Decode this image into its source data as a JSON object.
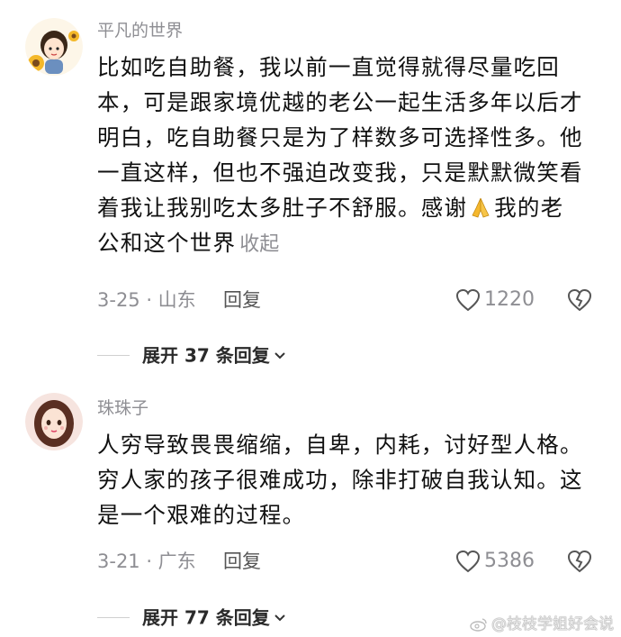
{
  "comments": [
    {
      "username": "平凡的世界",
      "avatar_icon": "girl-with-sunflower-avatar",
      "text_lines": [
        "比如吃自助餐，我以前一直觉得就得尽量吃回",
        "本，可是跟家境优越的老公一起生活多年以后才",
        "明白，吃自助餐只是为了样数多可选择性多。他",
        "一直这样，但也不强迫改变我，只是默默微笑看",
        "着我让我别吃太多肚子不舒服。感谢",
        "我的老"
      ],
      "text_line_6_pre": "公和这个世界",
      "collapse_label": "收起",
      "emoji": "folded-hands-emoji",
      "date_location": "3-25 · 山东",
      "reply_label": "回复",
      "like_count": "1220",
      "expand_label": "展开 37 条回复"
    },
    {
      "username": "珠珠子",
      "avatar_icon": "cartoon-girl-avatar",
      "text_lines": [
        "人穷导致畏畏缩缩，自卑，内耗，讨好型人格。",
        "穷人家的孩子很难成功，除非打破自我认知。这",
        "是一个艰难的过程。"
      ],
      "date_location": "3-21 · 广东",
      "reply_label": "回复",
      "like_count": "5386",
      "expand_label": "展开 77 条回复"
    }
  ],
  "watermark": "@枝枝学姐好会说",
  "colors": {
    "secondary_text": "#8e8e93",
    "primary_text": "#111111",
    "background": "#ffffff"
  }
}
